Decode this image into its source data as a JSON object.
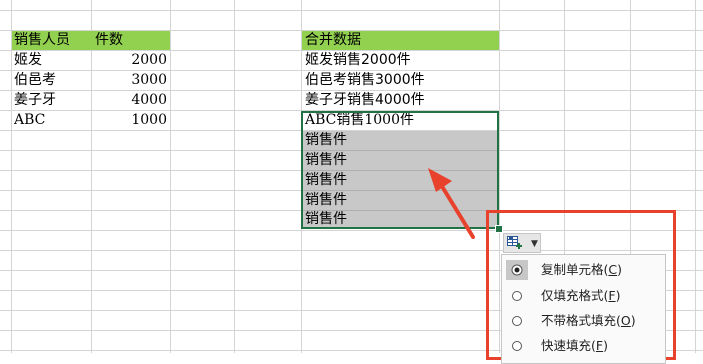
{
  "sheet": {
    "left_table": {
      "headers": [
        "销售人员",
        "件数"
      ],
      "rows": [
        {
          "name": "姬发",
          "count": "2000"
        },
        {
          "name": "伯邑考",
          "count": "3000"
        },
        {
          "name": "姜子牙",
          "count": "4000"
        },
        {
          "name": "ABC",
          "count": "1000"
        }
      ]
    },
    "right_table": {
      "header": "合并数据",
      "rows": [
        "姬发销售2000件",
        "伯邑考销售3000件",
        "姜子牙销售4000件",
        "ABC销售1000件"
      ],
      "filled_rows": [
        "销售件",
        "销售件",
        "销售件",
        "销售件",
        "销售件"
      ]
    },
    "header_fill_color": "#92d050",
    "selection_color": "#217346",
    "filled_cell_color": "#c8c8c8"
  },
  "annotation": {
    "arrow_color": "#e8412c",
    "box_color": "#e8412c"
  },
  "autofill": {
    "button_icon": "auto-fill-options-icon",
    "menu": [
      {
        "label": "复制单元格",
        "key": "C",
        "checked": true
      },
      {
        "label": "仅填充格式",
        "key": "F",
        "checked": false
      },
      {
        "label": "不带格式填充",
        "key": "O",
        "checked": false
      },
      {
        "label": "快速填充",
        "key": "F",
        "checked": false
      }
    ]
  }
}
